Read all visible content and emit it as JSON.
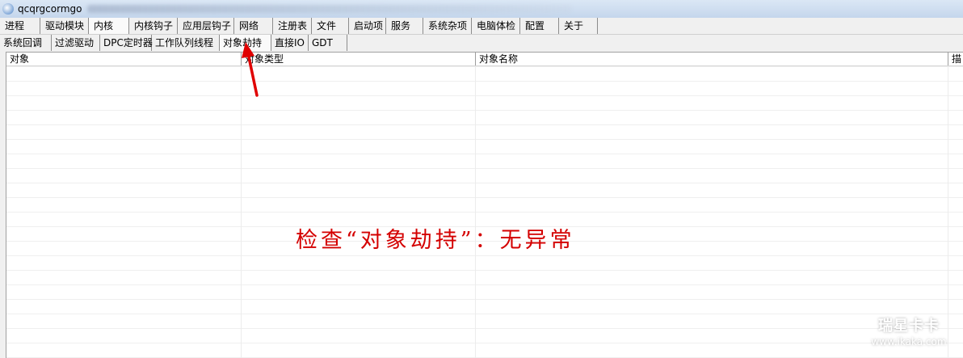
{
  "window": {
    "title": "qcqrgcormgo"
  },
  "main_tabs": [
    {
      "label": "进程"
    },
    {
      "label": "驱动模块"
    },
    {
      "label": "内核",
      "active": true
    },
    {
      "label": "内核钩子"
    },
    {
      "label": "应用层钩子"
    },
    {
      "label": "网络"
    },
    {
      "label": "注册表"
    },
    {
      "label": "文件"
    },
    {
      "label": "启动项"
    },
    {
      "label": "服务"
    },
    {
      "label": "系统杂项"
    },
    {
      "label": "电脑体检"
    },
    {
      "label": "配置"
    },
    {
      "label": "关于"
    }
  ],
  "sub_tabs": [
    {
      "label": "系统回调"
    },
    {
      "label": "过滤驱动"
    },
    {
      "label": "DPC定时器"
    },
    {
      "label": "工作队列线程"
    },
    {
      "label": "对象劫持",
      "active": true
    },
    {
      "label": "直接IO"
    },
    {
      "label": "GDT"
    }
  ],
  "table": {
    "columns": [
      {
        "label": "对象"
      },
      {
        "label": "对象类型"
      },
      {
        "label": "对象名称"
      },
      {
        "label": "描"
      }
    ]
  },
  "annotation": {
    "text": "检查“对象劫持”：无异常",
    "color": "#d40000"
  },
  "watermark": {
    "name": "瑞星卡卡",
    "url": "www.ikaka.com"
  }
}
